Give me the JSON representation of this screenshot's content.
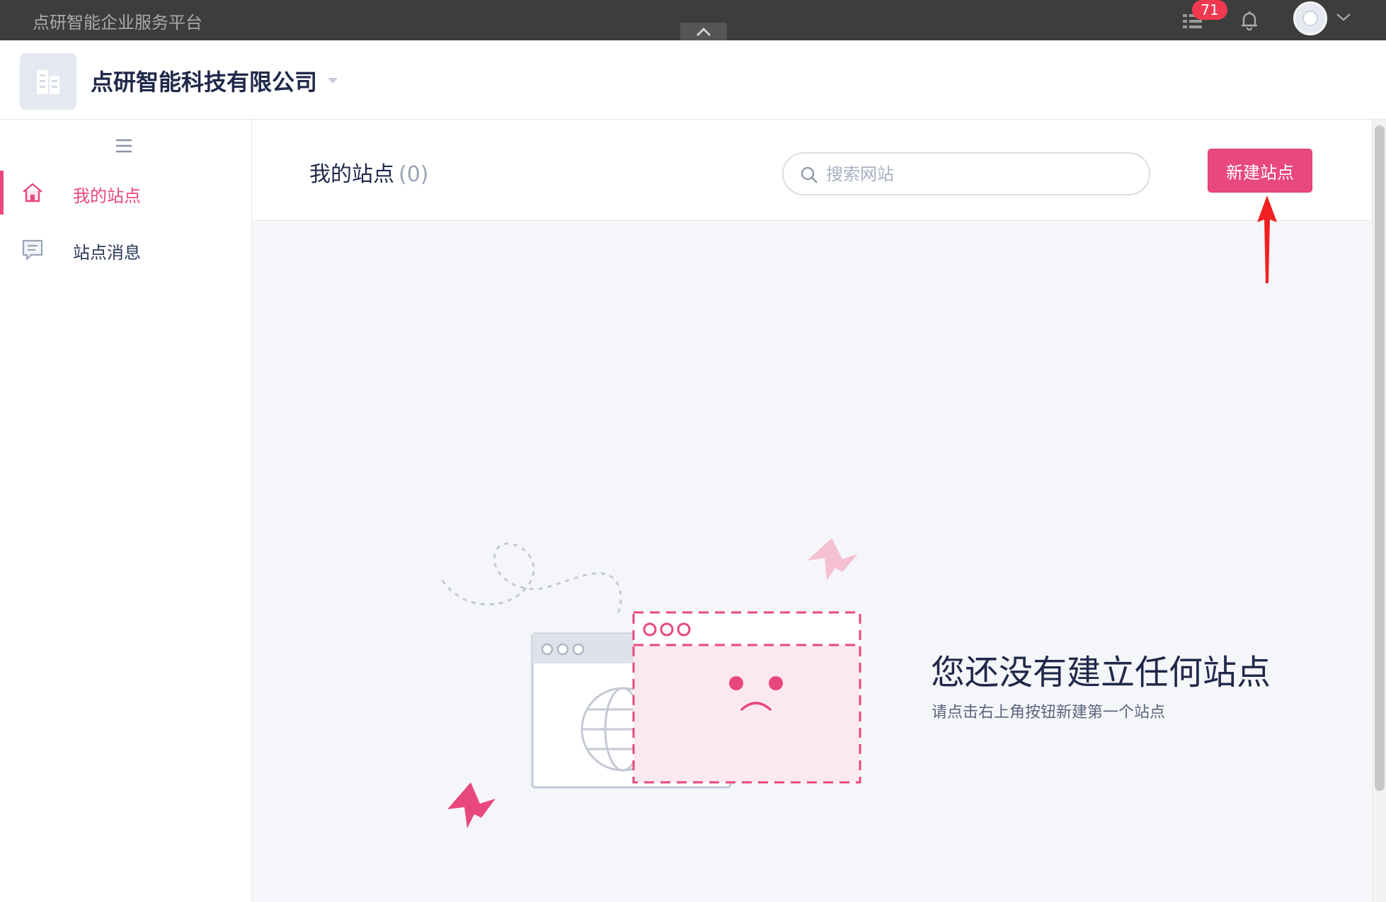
{
  "topbar": {
    "platform_title": "点研智能企业服务平台",
    "task_badge": "71",
    "icons": [
      "chevron-up-icon",
      "task-list-icon",
      "bell-icon",
      "avatar",
      "chevron-down-icon"
    ]
  },
  "company": {
    "name": "点研智能科技有限公司",
    "icons": [
      "building-icon",
      "caret-down-icon"
    ]
  },
  "sidebar": {
    "items": [
      {
        "label": "我的站点",
        "icon": "home-icon",
        "active": true
      },
      {
        "label": "站点消息",
        "icon": "message-icon",
        "active": false
      }
    ]
  },
  "main": {
    "title": "我的站点",
    "count": "(0)",
    "search_placeholder": "搜索网站",
    "new_button_label": "新建站点",
    "empty_title": "您还没有建立任何站点",
    "empty_subtitle": "请点击右上角按钮新建第一个站点"
  },
  "colors": {
    "accent": "#e9487d",
    "topbar_bg": "#3d3d3d",
    "badge": "#f0394f",
    "arrow": "#f02020",
    "canvas_bg": "#f5f6f9"
  }
}
